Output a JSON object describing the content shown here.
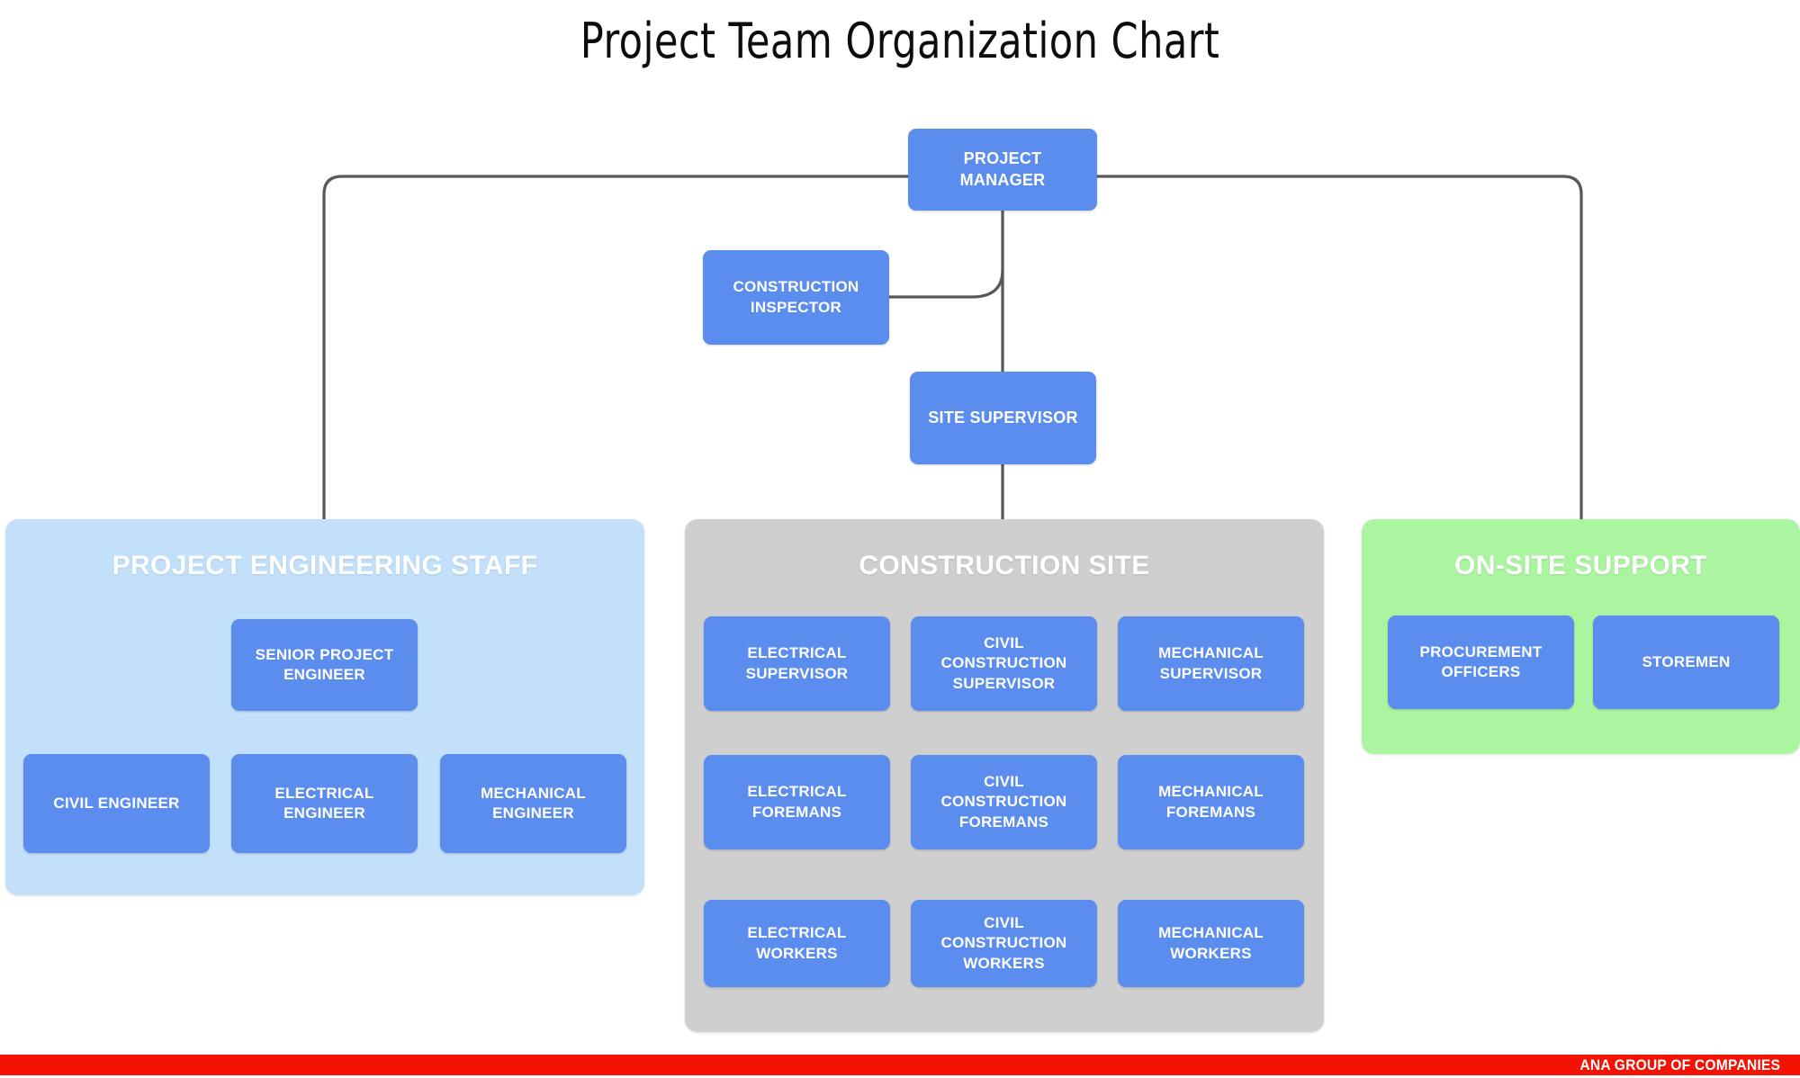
{
  "document": {
    "title": "Project Team Organization Chart"
  },
  "nodes": {
    "project_manager": "PROJECT\nMANAGER",
    "construction_inspector": "CONSTRUCTION\nINSPECTOR",
    "site_supervisor": "SITE SUPERVISOR"
  },
  "panels": {
    "engineering": {
      "title": "PROJECT ENGINEERING STAFF",
      "color": "#c2e0fa",
      "lead": "SENIOR PROJECT\nENGINEER",
      "members": [
        "CIVIL ENGINEER",
        "ELECTRICAL\nENGINEER",
        "MECHANICAL\nENGINEER"
      ]
    },
    "construction_site": {
      "title": "CONSTRUCTION SITE",
      "color": "#cfcfcf",
      "columns": [
        {
          "supervisor": "ELECTRICAL\nSUPERVISOR",
          "foremans": "ELECTRICAL\nFOREMANS",
          "workers": "ELECTRICAL\nWORKERS"
        },
        {
          "supervisor": "CIVIL\nCONSTRUCTION\nSUPERVISOR",
          "foremans": "CIVIL\nCONSTRUCTION\nFOREMANS",
          "workers": "CIVIL\nCONSTRUCTION\nWORKERS"
        },
        {
          "supervisor": "MECHANICAL\nSUPERVISOR",
          "foremans": "MECHANICAL\nFOREMANS",
          "workers": "MECHANICAL\nWORKERS"
        }
      ]
    },
    "on_site_support": {
      "title": "ON-SITE SUPPORT",
      "color": "#abf5a1",
      "members": [
        "PROCUREMENT\nOFFICERS",
        "STOREMEN"
      ]
    }
  },
  "footer": {
    "brand": "ANA GROUP OF COMPANIES",
    "bar_color": "#f41205"
  },
  "style": {
    "node_color": "#5b8def",
    "node_text_color": "#ffffff",
    "connector_color": "#58585a",
    "title_color": "#0d0d0d"
  }
}
